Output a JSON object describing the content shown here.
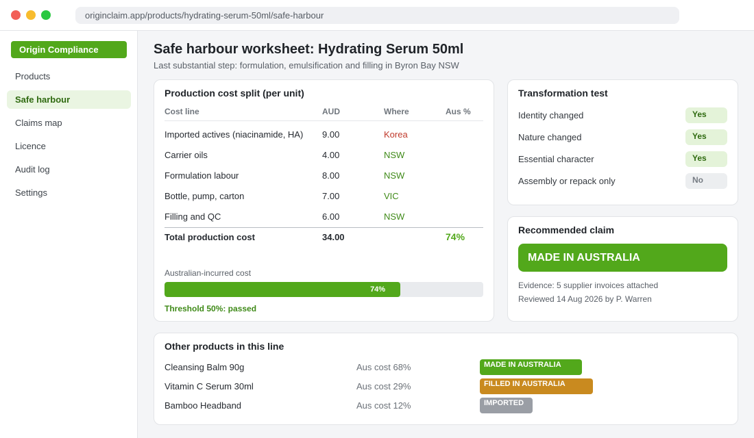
{
  "browser": {
    "url": "originclaim.app/products/hydrating-serum-50ml/safe-harbour"
  },
  "sidebar": {
    "brand": "Origin Compliance",
    "items": [
      {
        "label": "Products",
        "active": false
      },
      {
        "label": "Safe harbour",
        "active": true
      },
      {
        "label": "Claims map",
        "active": false
      },
      {
        "label": "Licence",
        "active": false
      },
      {
        "label": "Audit log",
        "active": false
      },
      {
        "label": "Settings",
        "active": false
      }
    ]
  },
  "header": {
    "title": "Safe harbour worksheet: Hydrating Serum 50ml",
    "subtitle": "Last substantial step: formulation, emulsification and filling in Byron Bay NSW"
  },
  "cost_split": {
    "title": "Production cost split (per unit)",
    "columns": [
      "Cost line",
      "AUD",
      "Where",
      "Aus %"
    ],
    "rows": [
      {
        "line": "Imported actives (niacinamide, HA)",
        "aud": "9.00",
        "where": "Korea",
        "australian": false
      },
      {
        "line": "Carrier oils",
        "aud": "4.00",
        "where": "NSW",
        "australian": true
      },
      {
        "line": "Formulation labour",
        "aud": "8.00",
        "where": "NSW",
        "australian": true
      },
      {
        "line": "Bottle, pump, carton",
        "aud": "7.00",
        "where": "VIC",
        "australian": true
      },
      {
        "line": "Filling and QC",
        "aud": "6.00",
        "where": "NSW",
        "australian": true
      }
    ],
    "total": {
      "label": "Total production cost",
      "aud": "34.00",
      "aus_pct": "74%"
    },
    "progress": {
      "label": "Australian-incurred cost",
      "value": 74,
      "text": "74%"
    },
    "threshold": "Threshold 50%: passed",
    "colors": {
      "foreign": "#c0392b",
      "australian": "#3f8a18",
      "accent": "#52a81b"
    }
  },
  "transformation_test": {
    "title": "Transformation test",
    "items": [
      {
        "label": "Identity changed",
        "result": "Yes"
      },
      {
        "label": "Nature changed",
        "result": "Yes"
      },
      {
        "label": "Essential character",
        "result": "Yes"
      },
      {
        "label": "Assembly or repack only",
        "result": "No"
      }
    ]
  },
  "recommended_claim": {
    "title": "Recommended claim",
    "claim": "MADE IN AUSTRALIA",
    "evidence": "Evidence: 5 supplier invoices attached",
    "reviewed": "Reviewed 14 Aug 2026 by P. Warren"
  },
  "other_products": {
    "title": "Other products in this line",
    "items": [
      {
        "name": "Cleansing Balm 90g",
        "cost": "Aus cost 68%",
        "claim": "MADE IN AUSTRALIA",
        "color": "#52a81b"
      },
      {
        "name": "Vitamin C Serum 30ml",
        "cost": "Aus cost 29%",
        "claim": "FILLED IN AUSTRALIA",
        "color": "#c98a1f"
      },
      {
        "name": "Bamboo Headband",
        "cost": "Aus cost 12%",
        "claim": "IMPORTED",
        "color": "#9a9ea5"
      }
    ]
  }
}
